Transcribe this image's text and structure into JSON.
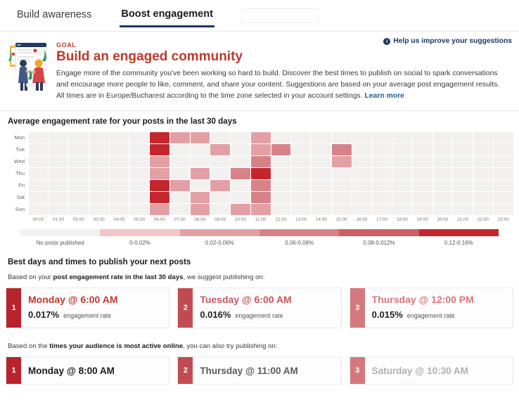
{
  "tabs": [
    {
      "label": "Build awareness",
      "active": false
    },
    {
      "label": "Boost engagement",
      "active": true
    },
    {
      "label": "",
      "active": false
    }
  ],
  "banner": {
    "goal_label": "GOAL",
    "title": "Build an engaged community",
    "description": "Engage more of the community you've been working so hard to build. Discover the best times to publish on social to spark conversations and encourage more people to like, comment, and share your content. Suggestions are based on your average post engagement results. All times are in Europe/Bucharest according to the time zone selected in your account settings.",
    "learn_more": "Learn more",
    "help_link": "Help us improve your suggestions",
    "info_icon": "info-icon",
    "illustration": "people-dashboard-illustration"
  },
  "heatmap": {
    "title": "Average engagement rate for your posts in the last 30 days",
    "days": [
      "Mon",
      "Tue",
      "Wed",
      "Thu",
      "Fri",
      "Sat",
      "Sun"
    ],
    "hours": [
      "00:00",
      "01:00",
      "02:00",
      "03:00",
      "04:00",
      "05:00",
      "06:00",
      "07:00",
      "08:00",
      "09:00",
      "10:00",
      "11:00",
      "12:00",
      "13:00",
      "14:00",
      "15:00",
      "16:00",
      "17:00",
      "18:00",
      "19:00",
      "20:00",
      "21:00",
      "22:00",
      "23:00"
    ],
    "legend": [
      {
        "label": "No posts published",
        "color": "#f2f1f0"
      },
      {
        "label": "0-0.02%",
        "color": "#f2c5c8"
      },
      {
        "label": "0.02-0.06%",
        "color": "#e3a0a4"
      },
      {
        "label": "0.06-0.08%",
        "color": "#d78288"
      },
      {
        "label": "0.08-0.012%",
        "color": "#cd5f66"
      },
      {
        "label": "0.12-0.16%",
        "color": "#c4262e"
      }
    ],
    "empty_color": "#f2f1f0"
  },
  "chart_data": {
    "type": "heatmap",
    "title": "Average engagement rate for your posts in the last 30 days",
    "xlabel": "",
    "ylabel": "",
    "x": [
      "00:00",
      "01:00",
      "02:00",
      "03:00",
      "04:00",
      "05:00",
      "06:00",
      "07:00",
      "08:00",
      "09:00",
      "10:00",
      "11:00",
      "12:00",
      "13:00",
      "14:00",
      "15:00",
      "16:00",
      "17:00",
      "18:00",
      "19:00",
      "20:00",
      "21:00",
      "22:00",
      "23:00"
    ],
    "y": [
      "Mon",
      "Tue",
      "Wed",
      "Thu",
      "Fri",
      "Sat",
      "Sun"
    ],
    "bins": [
      "No posts published",
      "0-0.02%",
      "0.02-0.06%",
      "0.06-0.08%",
      "0.08-0.012%",
      "0.12-0.16%"
    ],
    "bin_colors": [
      "#f2f1f0",
      "#f2c5c8",
      "#e3a0a4",
      "#d78288",
      "#cd5f66",
      "#c4262e"
    ],
    "legend_position": "bottom",
    "grid": true,
    "note": "values are bin indices 0-5; 0 = no posts published",
    "values": [
      [
        0,
        0,
        0,
        0,
        0,
        0,
        5,
        2,
        2,
        0,
        0,
        2,
        0,
        0,
        0,
        0,
        0,
        0,
        0,
        0,
        0,
        0,
        0,
        0
      ],
      [
        0,
        0,
        0,
        0,
        0,
        0,
        5,
        0,
        0,
        2,
        0,
        2,
        3,
        0,
        0,
        3,
        0,
        0,
        0,
        0,
        0,
        0,
        0,
        0
      ],
      [
        0,
        0,
        0,
        0,
        0,
        0,
        2,
        0,
        0,
        0,
        0,
        3,
        0,
        0,
        0,
        2,
        0,
        0,
        0,
        0,
        0,
        0,
        0,
        0
      ],
      [
        0,
        0,
        0,
        0,
        0,
        0,
        2,
        0,
        2,
        0,
        3,
        5,
        0,
        0,
        0,
        0,
        0,
        0,
        0,
        0,
        0,
        0,
        0,
        0
      ],
      [
        0,
        0,
        0,
        0,
        0,
        0,
        5,
        2,
        0,
        2,
        0,
        3,
        0,
        0,
        0,
        0,
        0,
        0,
        0,
        0,
        0,
        0,
        0,
        0
      ],
      [
        0,
        0,
        0,
        0,
        0,
        0,
        5,
        0,
        2,
        0,
        0,
        3,
        0,
        0,
        0,
        0,
        0,
        0,
        0,
        0,
        0,
        0,
        0,
        0
      ],
      [
        0,
        0,
        0,
        0,
        0,
        0,
        2,
        0,
        2,
        0,
        2,
        2,
        0,
        0,
        0,
        0,
        0,
        0,
        0,
        0,
        0,
        0,
        0,
        0
      ]
    ]
  },
  "suggestions": {
    "title": "Best days and times to publish your next posts",
    "engagement": {
      "intro_pre": "Based on your ",
      "intro_bold": "post engagement rate in the last 30 days",
      "intro_post": ", we suggest publishing on:",
      "metric_label": "engagement rate",
      "cards": [
        {
          "rank": "1",
          "when": "Monday  @ 6:00 AM",
          "metric": "0.017%",
          "rank_color": "#b8232c",
          "when_color": "#c0392b"
        },
        {
          "rank": "2",
          "when": "Tuesday  @ 6:00 AM",
          "metric": "0.016%",
          "rank_color": "#c04c52",
          "when_color": "#c8575c"
        },
        {
          "rank": "3",
          "when": "Thursday  @ 12:00 PM",
          "metric": "0.015%",
          "rank_color": "#d3797e",
          "when_color": "#d9777c"
        }
      ]
    },
    "active_times": {
      "intro_pre": "Based on the ",
      "intro_bold": "times your audience is most active online",
      "intro_post": ", you can also try publishing on:",
      "cards": [
        {
          "rank": "1",
          "when": "Monday  @ 8:00 AM",
          "rank_color": "#b8232c",
          "when_color": "#1b1b1b"
        },
        {
          "rank": "2",
          "when": "Thursday  @ 11:00 AM",
          "rank_color": "#c04c52",
          "when_color": "#5a5a5a"
        },
        {
          "rank": "3",
          "when": "Saturday  @ 10:30 AM",
          "rank_color": "#d3797e",
          "when_color": "#b0b0b0"
        }
      ]
    }
  }
}
